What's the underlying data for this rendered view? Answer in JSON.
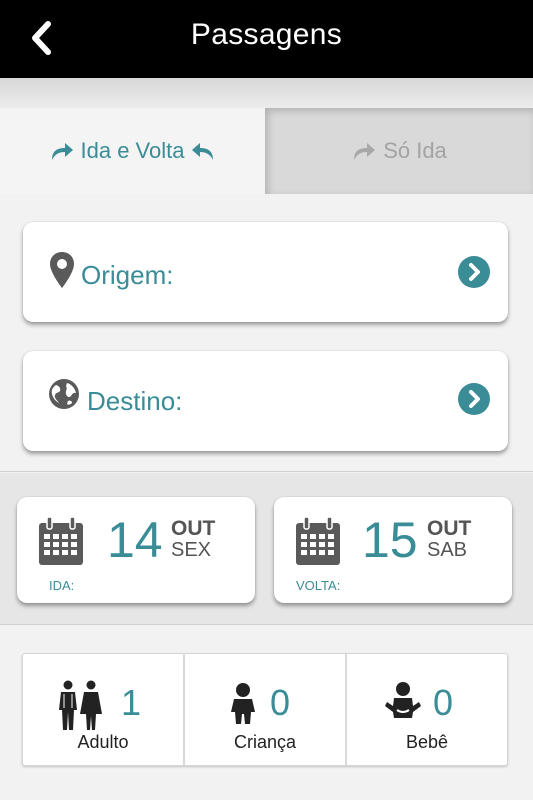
{
  "header": {
    "title": "Passagens",
    "back_icon": "chevron-left-icon"
  },
  "tabs": [
    {
      "label": "Ida e Volta",
      "active": true,
      "icons": [
        "share-forward-icon",
        "reply-icon"
      ]
    },
    {
      "label": "Só Ida",
      "active": false,
      "icons": [
        "share-forward-icon"
      ]
    }
  ],
  "origin": {
    "label": "Origem:",
    "icon": "map-pin-icon",
    "action_icon": "chevron-right-circle-icon"
  },
  "destination": {
    "label": "Destino:",
    "icon": "globe-icon",
    "action_icon": "chevron-right-circle-icon"
  },
  "dates": {
    "departure": {
      "day": "14",
      "month": "OUT",
      "weekday": "SEX",
      "caption": "IDA:",
      "icon": "calendar-icon"
    },
    "return": {
      "day": "15",
      "month": "OUT",
      "weekday": "SAB",
      "caption": "VOLTA:",
      "icon": "calendar-icon"
    }
  },
  "passengers": {
    "adult": {
      "count": "1",
      "label": "Adulto",
      "icon": "adults-couple-icon"
    },
    "child": {
      "count": "0",
      "label": "Criança",
      "icon": "child-icon"
    },
    "baby": {
      "count": "0",
      "label": "Bebê",
      "icon": "baby-icon"
    }
  },
  "colors": {
    "accent": "#3a8c96",
    "header_bg": "#000000",
    "inactive_tab": "#d9d9d9"
  }
}
